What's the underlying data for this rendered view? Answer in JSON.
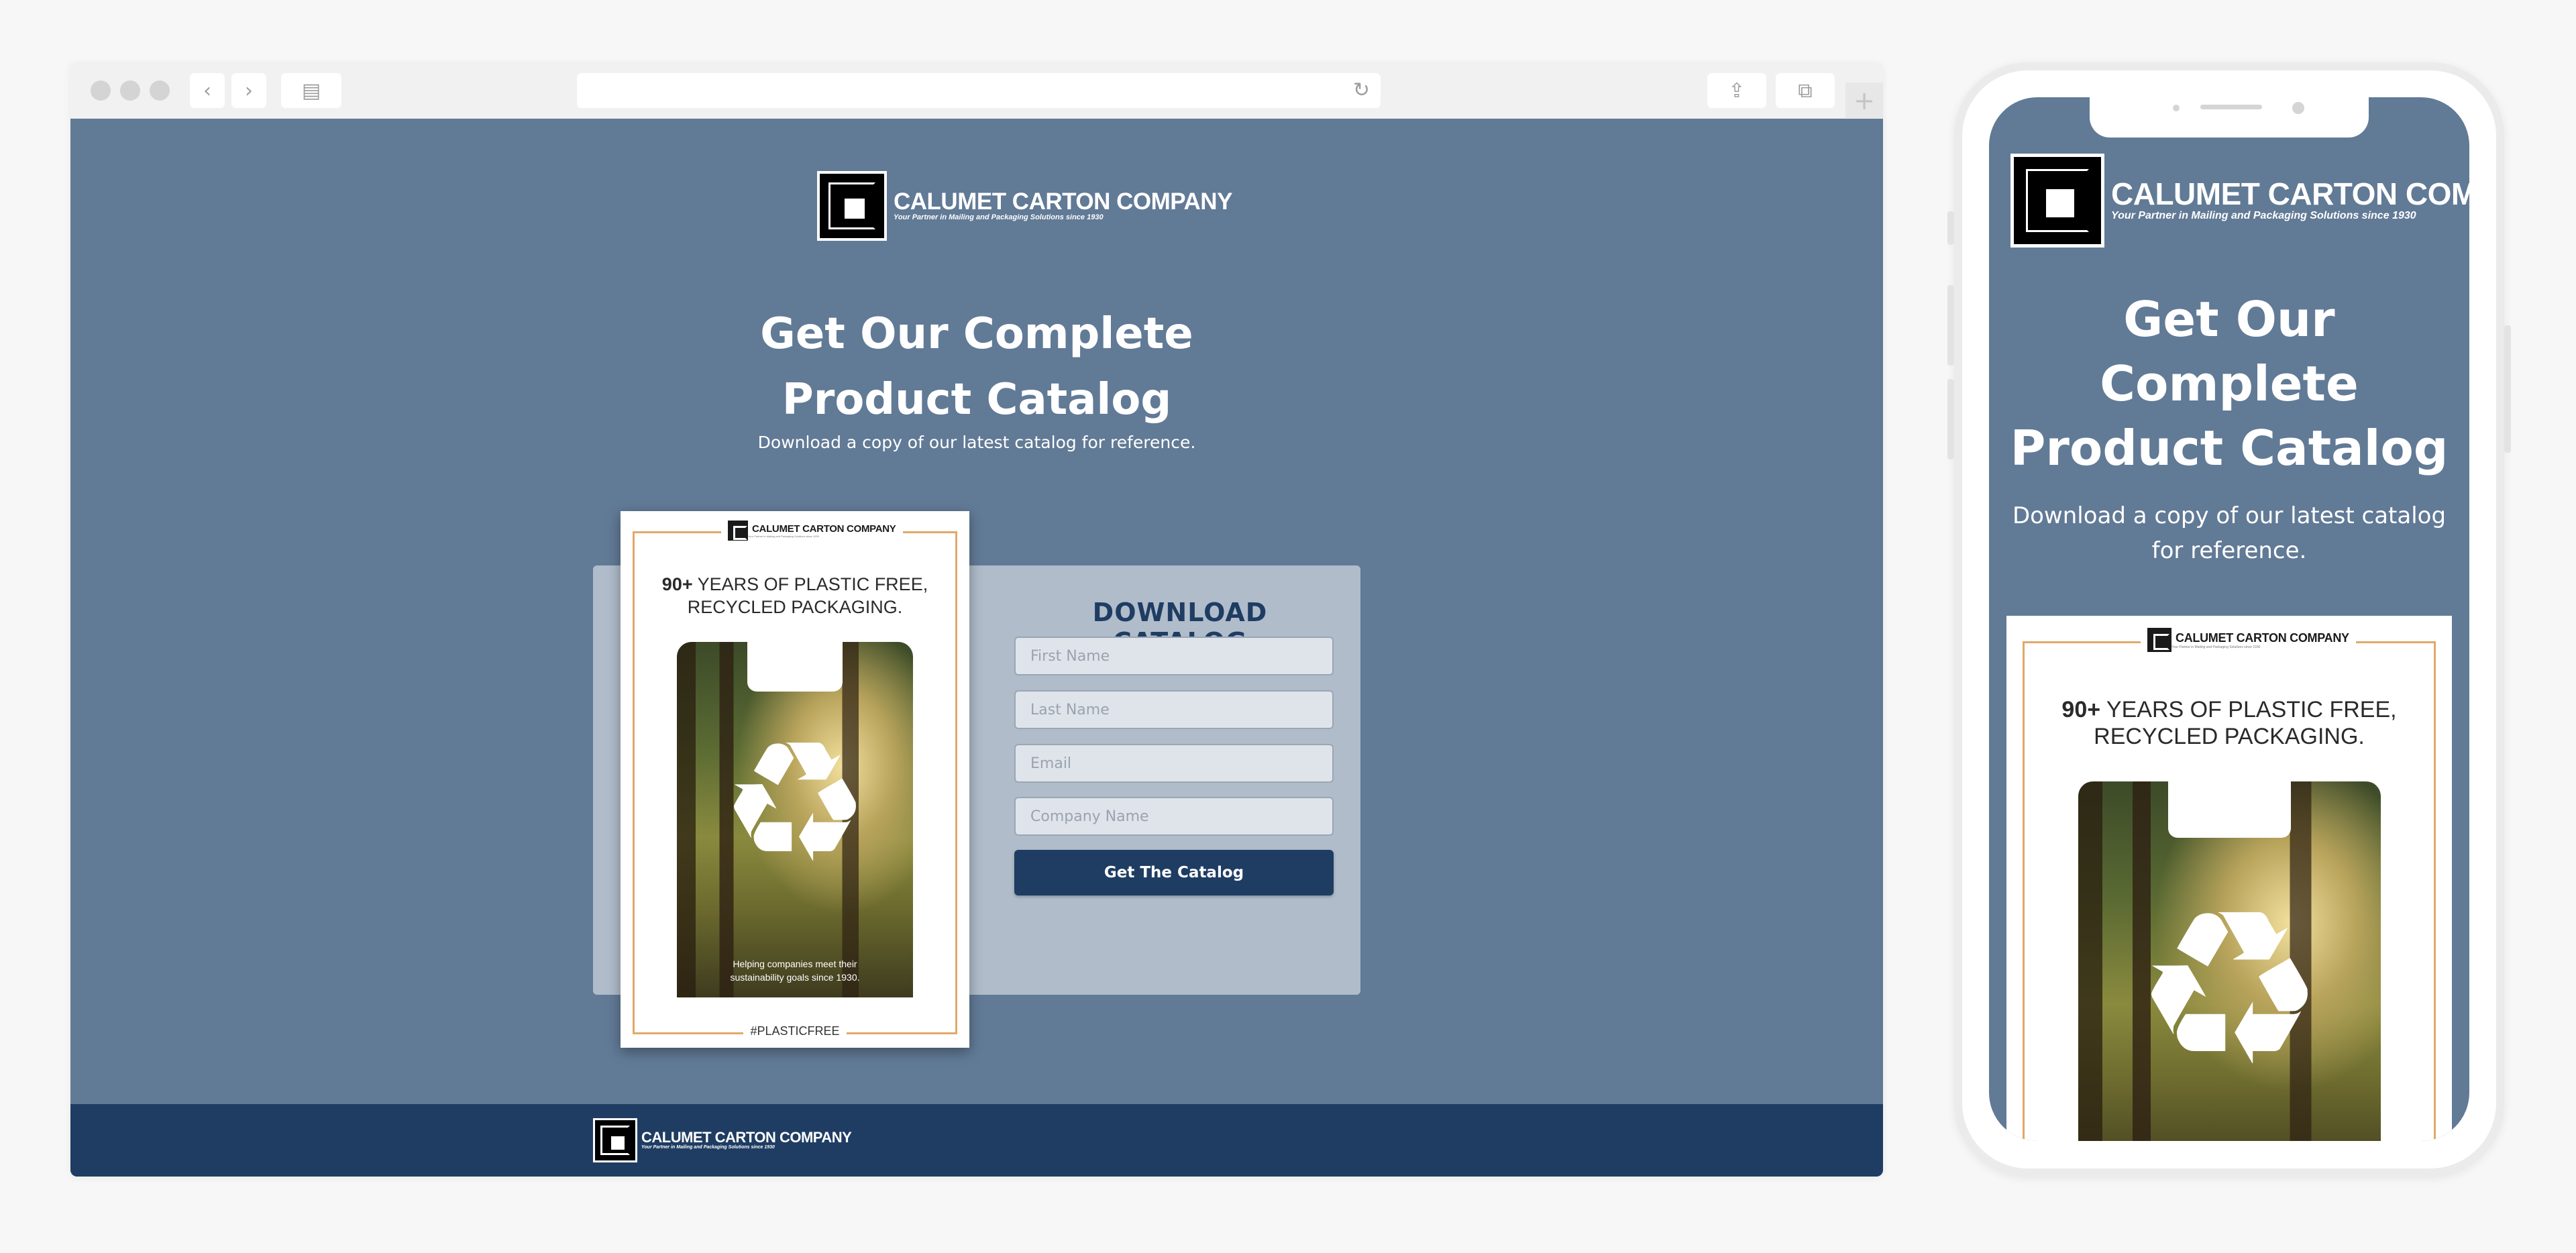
{
  "browser": {
    "url": "",
    "icons": {
      "back": "chevron-left-icon",
      "forward": "chevron-right-icon",
      "sidebar": "sidebar-icon",
      "reload": "reload-icon",
      "share": "share-icon",
      "tabs": "tabs-icon",
      "new_tab": "plus-icon"
    },
    "glyphs": {
      "back": "‹",
      "forward": "›",
      "sidebar": "▤",
      "reload": "↻",
      "share": "⇪",
      "tabs": "⧉",
      "new_tab": "+"
    }
  },
  "brand": {
    "name": "CALUMET CARTON COMPANY",
    "tagline": "Your Partner in Mailing and Packaging Solutions since 1930"
  },
  "hero": {
    "title_line1": "Get Our Complete",
    "title_line2": "Product Catalog",
    "subtitle": "Download a copy of our latest catalog for reference."
  },
  "form": {
    "title": "DOWNLOAD CATALOG",
    "first_name_placeholder": "First Name",
    "last_name_placeholder": "Last Name",
    "email_placeholder": "Email",
    "company_placeholder": "Company Name",
    "submit_label": "Get The Catalog"
  },
  "catalog_cover": {
    "headline_bold": "90+",
    "headline_line1": " YEARS OF PLASTIC FREE,",
    "headline_line2": "RECYCLED PACKAGING.",
    "caption_line1": "Helping companies meet their",
    "caption_line2": "sustainability goals since 1930.",
    "hashtag": "#PLASTICFREE",
    "recycle_glyph": "♻"
  },
  "mobile": {
    "title_line1": "Get Our",
    "title_line2": "Complete",
    "title_line3": "Product Catalog",
    "subtitle": "Download a copy of our latest catalog for reference."
  },
  "colors": {
    "page_bg": "#617a96",
    "navy": "#1f3d63",
    "form_panel": "#b0bcca",
    "cover_frame": "#e0a96a"
  }
}
